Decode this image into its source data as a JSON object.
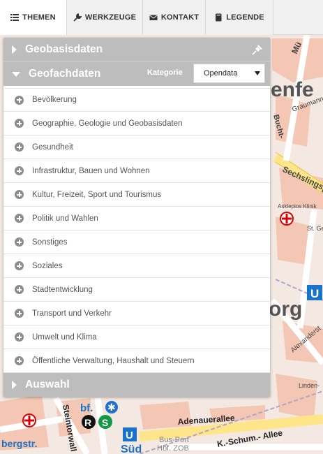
{
  "tabs": [
    {
      "label": "THEMEN",
      "icon": "list-icon",
      "active": true
    },
    {
      "label": "WERKZEUGE",
      "icon": "wrench-icon",
      "active": false
    },
    {
      "label": "KONTAKT",
      "icon": "envelope-icon",
      "active": false
    },
    {
      "label": "LEGENDE",
      "icon": "book-icon",
      "active": false
    }
  ],
  "panel": {
    "geobasis": {
      "title": "Geobasisdaten"
    },
    "geofach": {
      "title": "Geofachdaten",
      "kategorie_label": "Kategorie",
      "kategorie_value": "Opendata"
    },
    "categories": [
      "Bevölkerung",
      "Geographie, Geologie und Geobasisdaten",
      "Gesundheit",
      "Infrastruktur, Bauen und Wohnen",
      "Kultur, Freizeit, Sport und Tourismus",
      "Politik und Wahlen",
      "Sonstiges",
      "Soziales",
      "Stadtentwicklung",
      "Transport und Verkehr",
      "Umwelt und Klima",
      "Öffentliche Verwaltung, Haushalt und Steuern"
    ],
    "auswahl": {
      "title": "Auswahl"
    }
  },
  "map": {
    "labels": {
      "top_right": "Mü",
      "enfe": "enfe",
      "bucht": "Bucht-",
      "graumann": "Graumanns",
      "sechsling": "Sechslingsp",
      "klinik": "Asklepios Klinik",
      "stgeor": "St. Geor",
      "org": "org",
      "alexander": "Alexanderst",
      "linden": "Linden-",
      "adenauer": "Adenauerallee",
      "kschum": "K.-Schum.- Allee",
      "bergstr": "bergstr.",
      "steintorwall": "Steintorwall",
      "bf": "bf.",
      "sued": "Süd",
      "busport": "Bus-Port",
      "hbf": "Hbf. ZOB",
      "u": "U",
      "r": "R",
      "s": "S"
    },
    "colors": {
      "block": "#f4c7b5",
      "road": "#ffffff",
      "main_road": "#ffe58a",
      "rail": "#b0a5c8",
      "accent_blue": "#1a73c8"
    }
  }
}
